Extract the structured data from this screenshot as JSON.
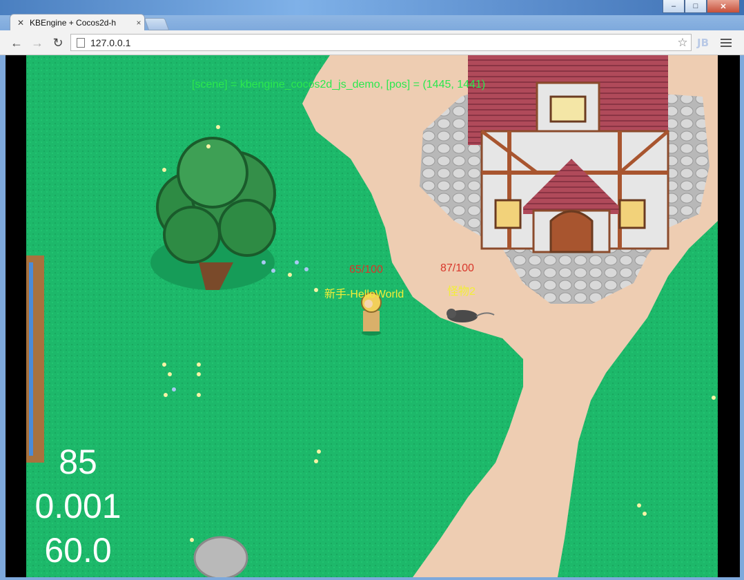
{
  "browser": {
    "tab_title": "KBEngine + Cocos2d-h",
    "tab_close": "×",
    "url": "127.0.0.1",
    "window_controls": {
      "minimize": "–",
      "maximize": "□",
      "close": "✕"
    },
    "extension_label": "JB"
  },
  "game": {
    "scene_info": "[scene] = kbengine_cocos2d_js_demo, [pos] = (1445, 1441)",
    "player": {
      "hp": "65/100",
      "name": "新手-HelloWorld"
    },
    "monster": {
      "hp": "87/100",
      "name": "怪物2"
    },
    "stats": {
      "draw_calls": "85",
      "frame_time": "0.001",
      "fps": "60.0"
    }
  },
  "colors": {
    "grass": "#1db86a",
    "path": "#eecdb2",
    "stone": "#c9c9c9",
    "scene_text": "#2be84e",
    "hp_text": "#d8362a",
    "name_text": "#f2ee38"
  }
}
